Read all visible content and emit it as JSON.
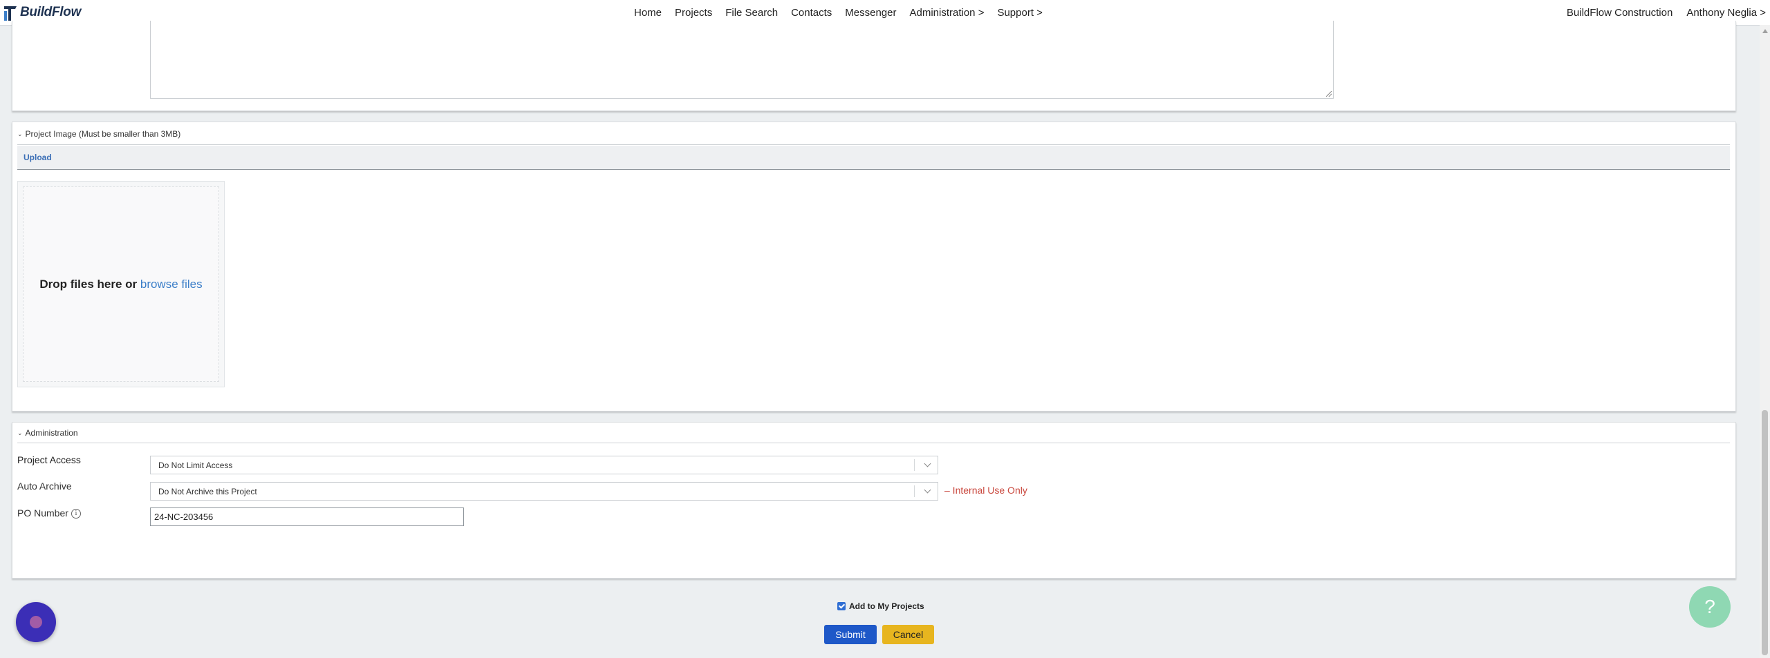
{
  "app": {
    "name": "BuildFlow"
  },
  "nav": {
    "items": [
      "Home",
      "Projects",
      "File Search",
      "Contacts",
      "Messenger",
      "Administration >",
      "Support >"
    ],
    "company": "BuildFlow Construction",
    "user": "Anthony Neglia >"
  },
  "image_section": {
    "title": "Project Image (Must be smaller than 3MB)",
    "upload_label": "Upload",
    "drop_text": "Drop files here or ",
    "browse_text": "browse files"
  },
  "admin_section": {
    "title": "Administration",
    "project_access": {
      "label": "Project Access",
      "value": "Do Not Limit Access"
    },
    "auto_archive": {
      "label": "Auto Archive",
      "value": "Do Not Archive this Project",
      "note": "– Internal Use Only"
    },
    "po_number": {
      "label": "PO Number",
      "value": "24-NC-203456"
    }
  },
  "footer": {
    "add_to_my_projects": "Add to My Projects",
    "add_to_my_projects_checked": true,
    "submit_label": "Submit",
    "cancel_label": "Cancel"
  },
  "help": {
    "icon_text": "?"
  },
  "colors": {
    "brand": "#1f3352",
    "link": "#3b7ec8",
    "submit": "#1e58c8",
    "cancel": "#e7b51f",
    "warning": "#c9473d",
    "chat": "#3b2eb6",
    "help": "#8fd8b3"
  }
}
